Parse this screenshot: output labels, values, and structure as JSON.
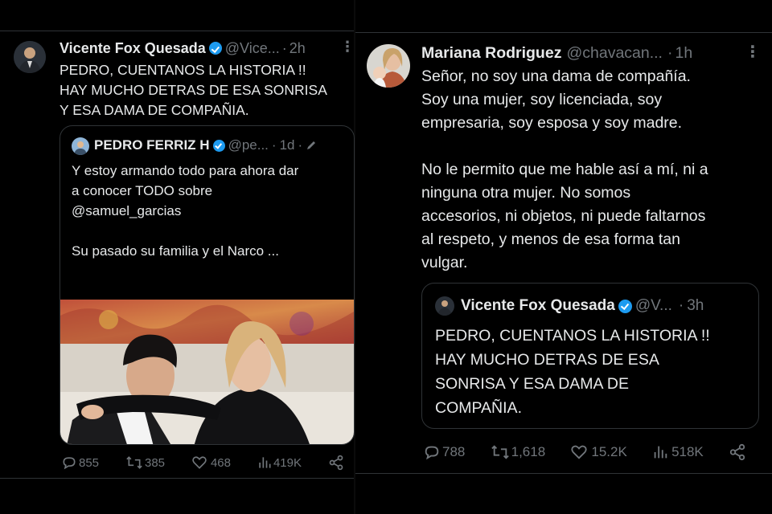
{
  "left_tweet": {
    "author_name": "Vicente Fox Quesada",
    "handle": "@Vice...",
    "separator": "·",
    "time": "2h",
    "text": "PEDRO, CUENTANOS LA HISTORIA !!\nHAY MUCHO DETRAS DE ESA SONRISA\nY ESA DAMA DE COMPAÑIA.",
    "quoted": {
      "author_name": "PEDRO FERRIZ H",
      "handle": "@pe...",
      "separator": "·",
      "time": "1d",
      "text": "Y estoy armando todo para ahora dar\na conocer TODO sobre\n@samuel_garcias\n\nSu pasado su familia y  el Narco ..."
    },
    "stats": {
      "replies": "855",
      "reposts": "385",
      "likes": "468",
      "views": "419K"
    }
  },
  "right_tweet": {
    "author_name": "Mariana Rodriguez",
    "handle": "@chavacan...",
    "separator": "·",
    "time": "1h",
    "text": "Señor, no soy una dama de compañía.\nSoy una mujer, soy licenciada, soy\nempresaria, soy esposa y soy madre.\n\nNo le permito que me hable así a mí, ni a\nninguna otra mujer. No somos\naccesorios, ni objetos, ni puede faltarnos\nal respeto, y menos de esa forma tan\nvulgar.",
    "quoted": {
      "author_name": "Vicente Fox Quesada",
      "handle": "@V...",
      "separator": "·",
      "time": "3h",
      "text": "PEDRO, CUENTANOS LA HISTORIA !!\nHAY MUCHO DETRAS DE ESA\nSONRISA Y ESA DAMA DE\nCOMPAÑIA."
    },
    "stats": {
      "replies": "788",
      "reposts": "1,618",
      "likes": "15.2K",
      "views": "518K"
    }
  },
  "colors": {
    "background": "#000000",
    "text": "#e7e9ea",
    "muted": "#71767b",
    "border": "#2f3336",
    "verified": "#1d9bf0"
  },
  "icons": [
    "reply-icon",
    "repost-icon",
    "like-icon",
    "views-icon",
    "share-icon",
    "more-icon",
    "verified-icon",
    "edit-icon",
    "camera-lens-icon"
  ]
}
